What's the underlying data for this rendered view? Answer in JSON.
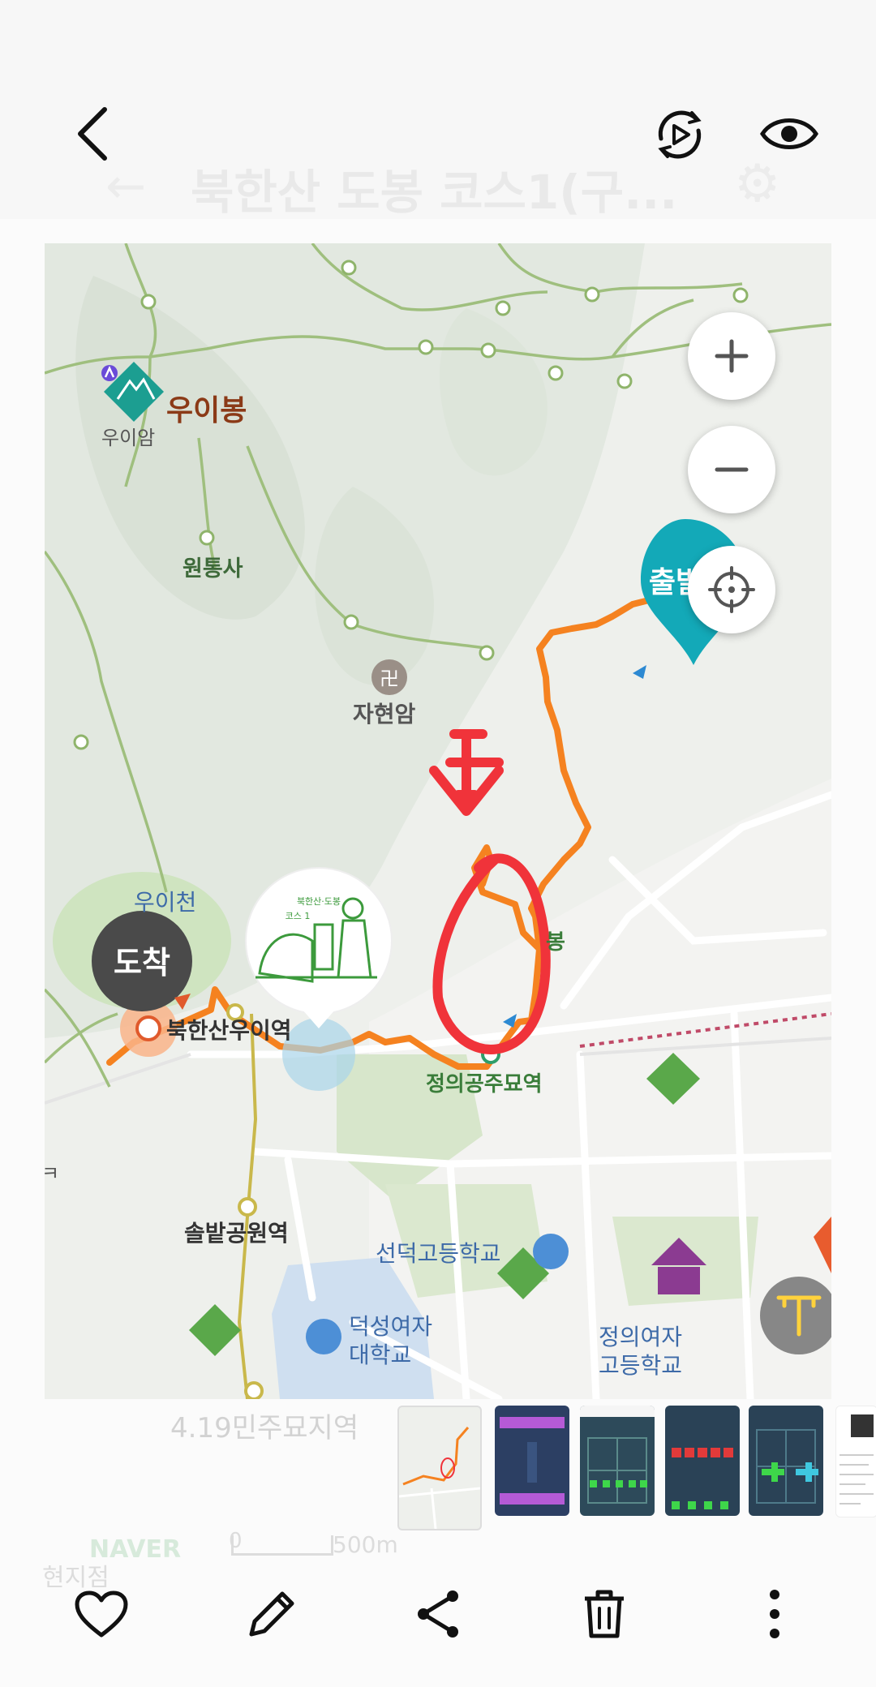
{
  "header": {
    "background_title": "북한산 도봉 코스1(구...",
    "icons": [
      "back-icon",
      "motion-photo-icon",
      "eye-icon"
    ]
  },
  "map": {
    "labels": {
      "peak": "우이봉",
      "peak_sub": "우이암",
      "temple1": "원통사",
      "temple2": "자현암",
      "stream": "우이천",
      "arrival": "도착",
      "start": "출발",
      "station1": "북한산우이역",
      "station2": "정의공주묘역",
      "station3": "솔밭공원역",
      "peak2": "봉",
      "school1": "선덕고등학교",
      "school2_line1": "덕성여자",
      "school2_line2": "대학교",
      "school3_line1": "정의여자",
      "school3_line2": "고등학교",
      "edge_label": "ㅋ",
      "badge_line1": "북한산·도봉",
      "badge_line2": "코스 1"
    },
    "controls": [
      "zoom-in-icon",
      "zoom-out-icon",
      "locate-icon",
      "text-extract-icon"
    ],
    "route_color": "#f58220",
    "annotation_color": "#f0333a"
  },
  "bottom_ghost": {
    "station": "4.19민주묘지역",
    "brand": "NAVER",
    "scale_left": "0",
    "scale_right": "500m",
    "location": "현지점"
  },
  "filmstrip": {
    "thumbnails": [
      "map-thumbnail",
      "game-thumbnail-1",
      "game-thumbnail-2",
      "game-thumbnail-3",
      "game-thumbnail-4",
      "document-thumbnail"
    ]
  },
  "actions": [
    "heart-icon",
    "edit-icon",
    "share-icon",
    "delete-icon",
    "more-icon"
  ]
}
